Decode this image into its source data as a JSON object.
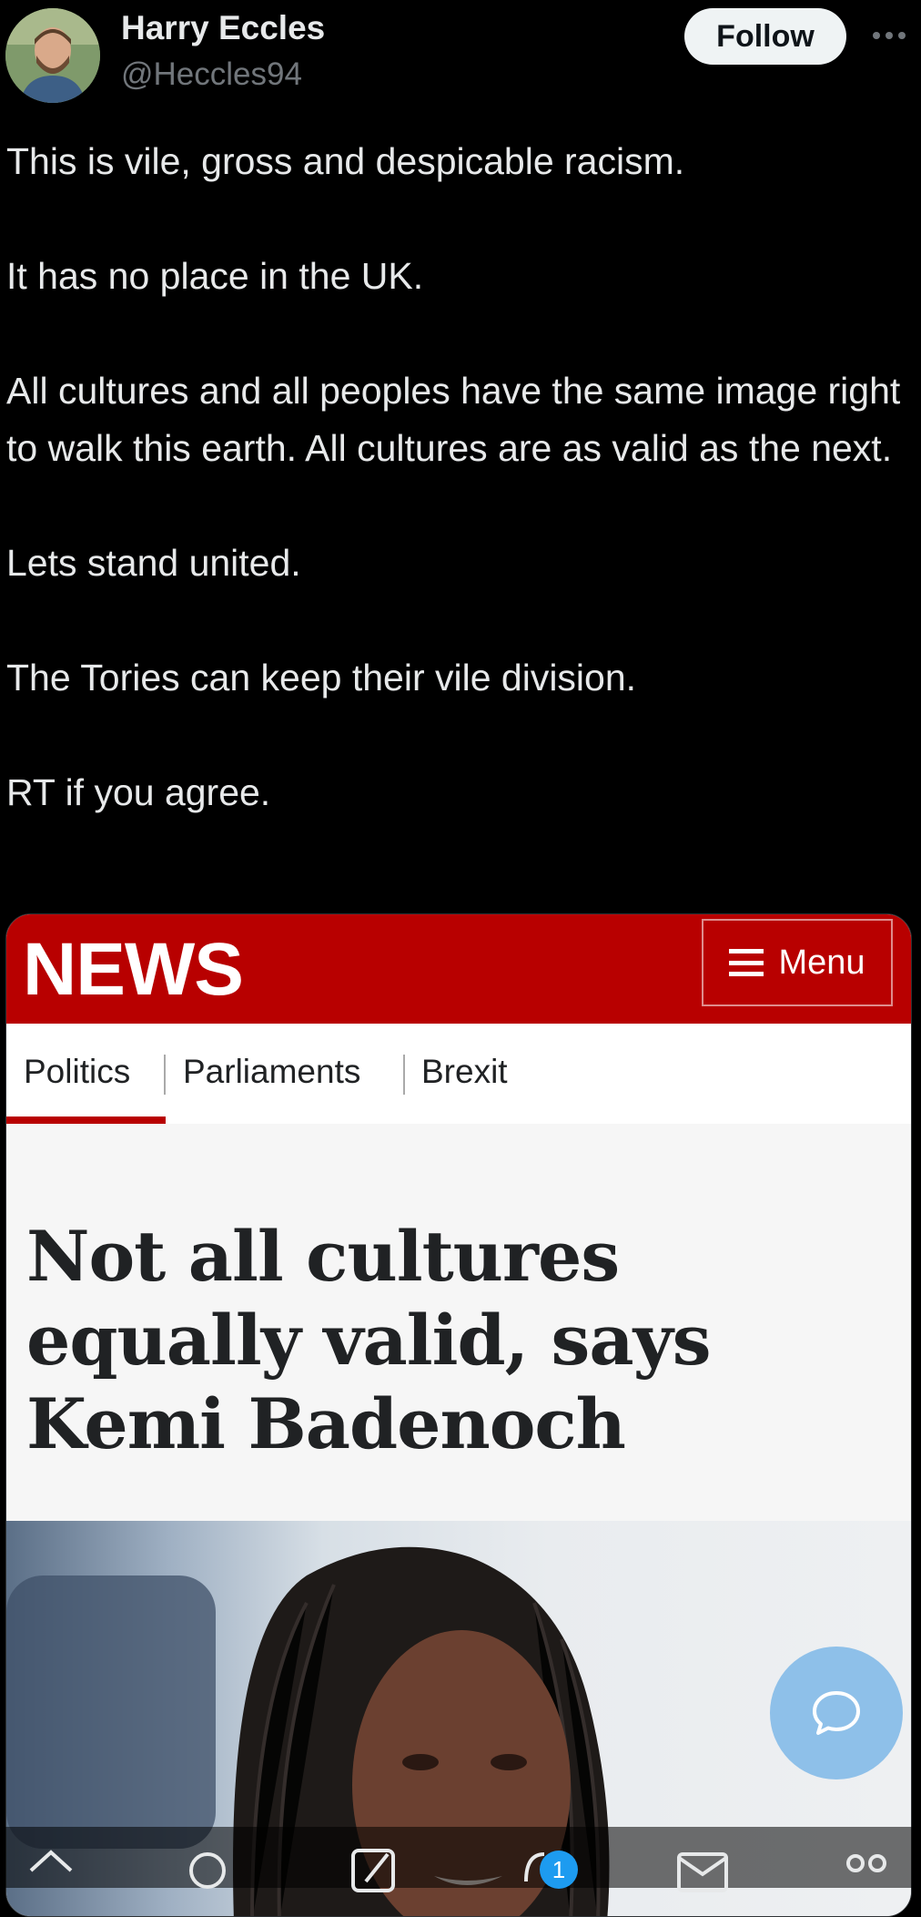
{
  "tweet": {
    "author": {
      "name": "Harry Eccles",
      "handle": "@Heccles94"
    },
    "follow_label": "Follow",
    "paragraphs": [
      "This is vile, gross and despicable racism.",
      "It has no place in the UK.",
      "All cultures and all peoples have the same image right to walk this earth. All cultures are as valid as the next.",
      "Lets stand united.",
      "The Tories can keep their vile division.",
      "RT if you agree."
    ]
  },
  "media": {
    "brand": "NEWS",
    "menu_label": "Menu",
    "nav": [
      "Politics",
      "Parliaments",
      "Brexit"
    ],
    "headline": "Not all cultures equally valid, says Kemi Badenoch",
    "accent_color": "#b80000"
  },
  "bottom_nav": {
    "messages_badge": "1"
  },
  "colors": {
    "background": "#000000",
    "text": "#e7e9ea",
    "muted": "#71767b",
    "fab": "#8ec0e9"
  }
}
